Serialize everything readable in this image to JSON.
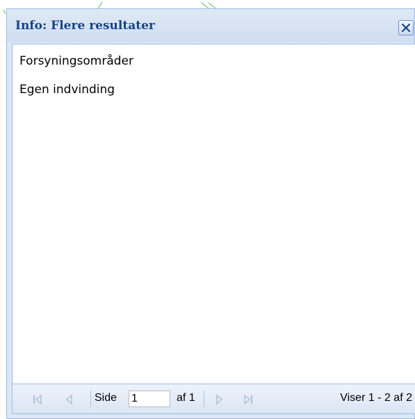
{
  "window": {
    "title": "Info: Flere resultater",
    "close_icon": "close-icon"
  },
  "results": {
    "items": [
      {
        "label": "Forsyningsområder"
      },
      {
        "label": "Egen indvinding"
      }
    ]
  },
  "pager": {
    "first_icon": "first-page-icon",
    "prev_icon": "prev-page-icon",
    "next_icon": "next-page-icon",
    "last_icon": "last-page-icon",
    "page_label": "Side",
    "page_value": "1",
    "of_label": "af 1",
    "status": "Viser 1 - 2 af 2"
  },
  "colors": {
    "title": "#15428b",
    "border": "#99bbe8",
    "header_bg": "#dbe7f6",
    "disabled_icon": "#a9bfd6"
  }
}
